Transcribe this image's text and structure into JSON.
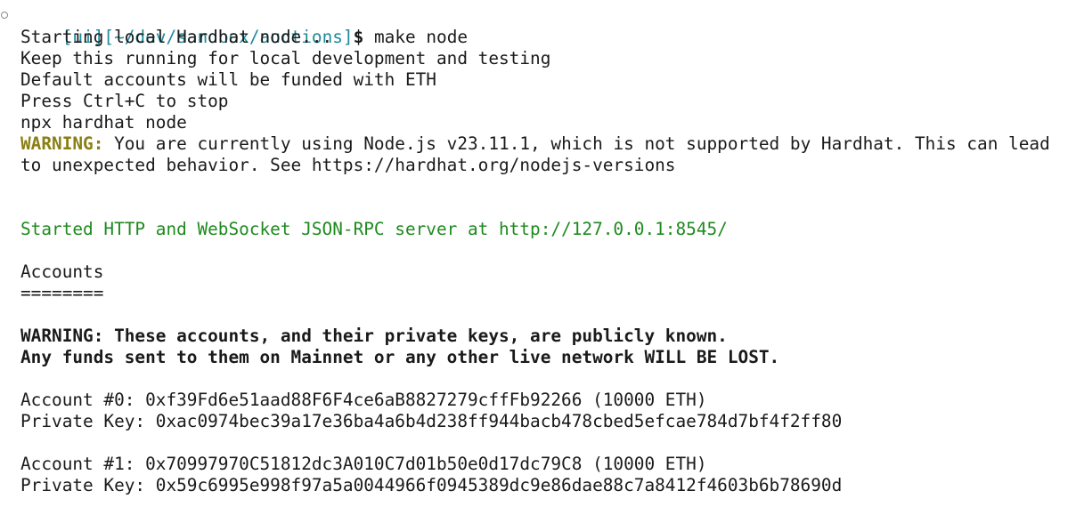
{
  "prompt": {
    "marker": "○",
    "ui_tag": "[ui]",
    "path": "[~/dev/sandbox/auctions]",
    "symbol": "$",
    "command": "make node"
  },
  "intro_lines": [
    "Starting local Hardhat node...",
    "Keep this running for local development and testing",
    "Default accounts will be funded with ETH",
    "Press Ctrl+C to stop",
    "npx hardhat node"
  ],
  "node_warning": {
    "label": "WARNING:",
    "text_1": " You are currently using Node.js v23.11.1, which is not supported by Hardhat. This can lead",
    "text_2": "to unexpected behavior. See https://hardhat.org/nodejs-versions"
  },
  "server_line": "Started HTTP and WebSocket JSON-RPC server at http://127.0.0.1:8545/",
  "accounts_heading": "Accounts",
  "accounts_rule": "========",
  "keys_warning": {
    "line_1": "WARNING: These accounts, and their private keys, are publicly known.",
    "line_2": "Any funds sent to them on Mainnet or any other live network WILL BE LOST."
  },
  "accounts": [
    {
      "account_line": "Account #0: 0xf39Fd6e51aad88F6F4ce6aB8827279cffFb92266 (10000 ETH)",
      "key_line": "Private Key: 0xac0974bec39a17e36ba4a6b4d238ff944bacb478cbed5efcae784d7bf4f2ff80"
    },
    {
      "account_line": "Account #1: 0x70997970C51812dc3A010C7d01b50e0d17dc79C8 (10000 ETH)",
      "key_line": "Private Key: 0x59c6995e998f97a5a0044966f0945389dc9e86dae88c7a8412f4603b6b78690d"
    }
  ],
  "colors": {
    "teal": "#1f8a99",
    "warning_yellow": "#8a7f12",
    "green": "#1e8a1e",
    "text": "#1a1a1a",
    "background": "#ffffff"
  }
}
